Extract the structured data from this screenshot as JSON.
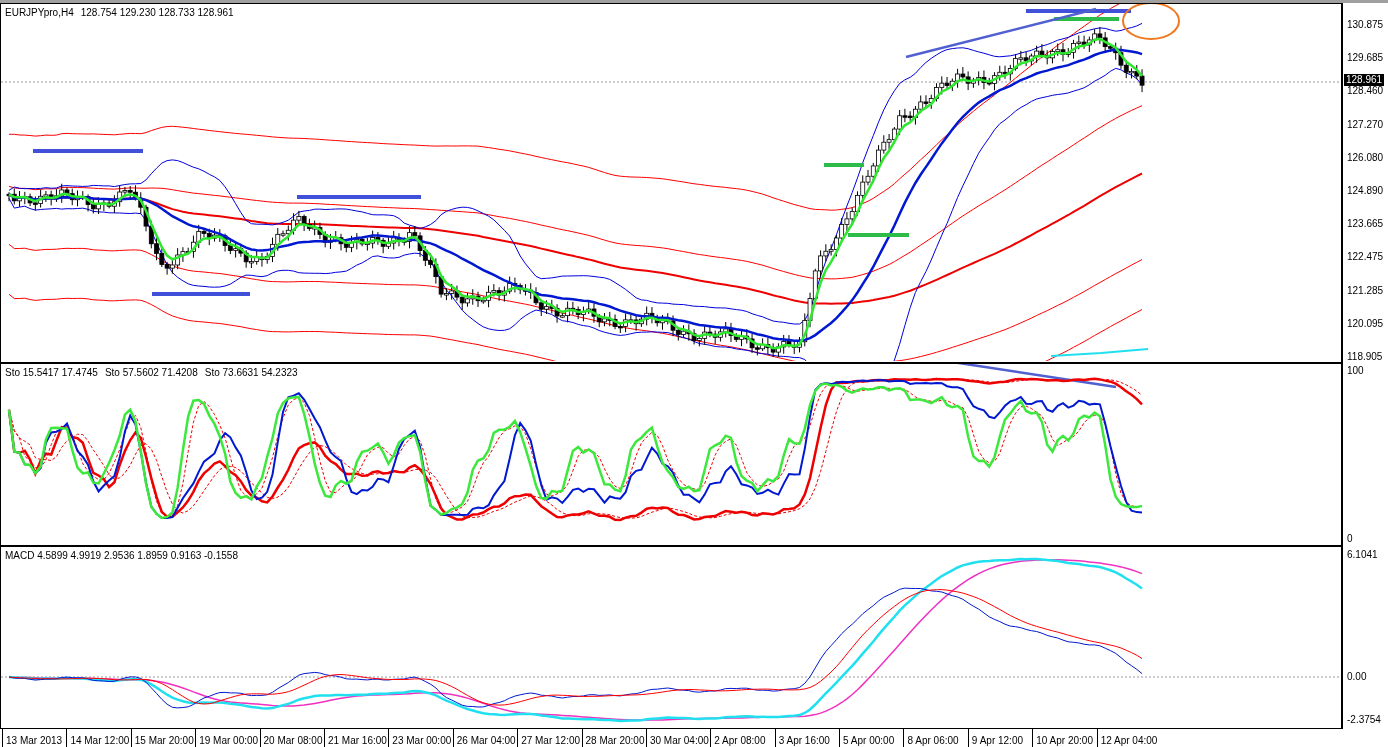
{
  "chart": {
    "title": "EURJPYpro,H4",
    "ohlc": [
      "128.754",
      "129.230",
      "128.733",
      "128.961"
    ]
  },
  "price_axis": {
    "labels": [
      "130.875",
      "129.685",
      "128.460",
      "127.270",
      "126.080",
      "124.890",
      "123.665",
      "122.475",
      "121.285",
      "120.095",
      "118.905"
    ],
    "current_price": "128.961"
  },
  "stochastic": {
    "legend": [
      "Sto 15.5417 17.4745",
      "Sto 57.5602 71.4208",
      "Sto 73.6631 54.2323"
    ],
    "axis_labels": [
      "100",
      "0"
    ]
  },
  "macd": {
    "legend": "MACD 4.5899 4.9919 2.9536 1.8959 0.9163 -0.1558",
    "axis_labels": [
      "6.1041",
      "0.00",
      "-2.3754"
    ]
  },
  "time_axis": [
    "13 Mar 2013",
    "14 Mar 12:00",
    "15 Mar 20:00",
    "19 Mar 00:00",
    "20 Mar 08:00",
    "21 Mar 16:00",
    "23 Mar 00:00",
    "26 Mar 04:00",
    "27 Mar 12:00",
    "28 Mar 20:00",
    "30 Mar 04:00",
    "2 Apr 08:00",
    "3 Apr 16:00",
    "5 Apr 00:00",
    "8 Apr 06:00",
    "9 Apr 12:00",
    "10 Apr 20:00",
    "12 Apr 04:00"
  ]
}
